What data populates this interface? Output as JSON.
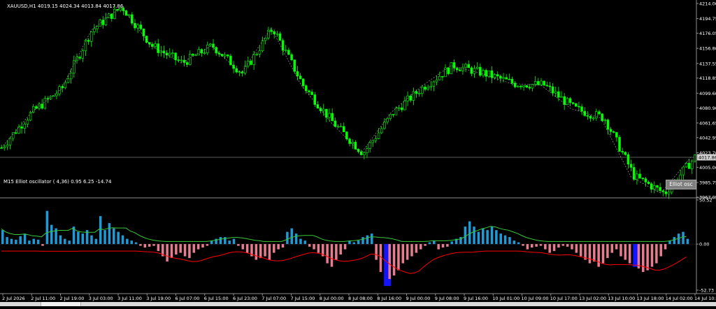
{
  "main": {
    "header": "XAUUSD,H1  4019.15 4024.34 4013.84 4017.86",
    "price_ticks": [
      "4214.00",
      "4194.75",
      "4176.05",
      "4156.80",
      "4137.55",
      "4118.85",
      "4099.60",
      "4080.90",
      "4061.65",
      "4042.95",
      "4023.70",
      "4005.00",
      "3985.75",
      "3967.05"
    ],
    "price_ticks_values": [
      4214.0,
      4194.75,
      4176.05,
      4156.8,
      4137.55,
      4118.85,
      4099.6,
      4080.9,
      4061.65,
      4042.95,
      4023.7,
      4005.0,
      3985.75,
      3967.05
    ],
    "current_price": "4017.86",
    "current_price_value": 4017.86
  },
  "oscillator": {
    "header": "M15 Elliot oscillator ( 4,36) 0.95 6.25 -14.74",
    "button_label": "Elliot osc",
    "ticks": [
      "50.52",
      "0.00",
      "-52.73"
    ],
    "tick_values": [
      50.52,
      0.0,
      -52.73
    ]
  },
  "time_axis": [
    "2 Jul 2026",
    "2 Jul 11:00",
    "2 Jul 19:00",
    "3 Jul 03:00",
    "3 Jul 11:00",
    "3 Jul 19:00",
    "6 Jul 07:00",
    "6 Jul 15:00",
    "6 Jul 23:00",
    "7 Jul 07:00",
    "7 Jul 15:00",
    "8 Jul 00:00",
    "8 Jul 08:00",
    "8 Jul 16:00",
    "9 Jul 00:00",
    "9 Jul 08:00",
    "9 Jul 16:00",
    "10 Jul 01:00",
    "10 Jul 09:00",
    "10 Jul 17:00",
    "13 Jul 02:00",
    "13 Jul 10:00",
    "13 Jul 18:00",
    "14 Jul 02:00",
    "14 Jul 10:00"
  ],
  "colors": {
    "bull": "#00ff00",
    "bear": "#00ff00",
    "osc_pos": "#1e9ad6",
    "osc_neg": "#e77c8f",
    "signal": "#38c938",
    "signal2": "#ff0000",
    "highlight": "#1414ff",
    "zigzag": "#b0b0b0"
  },
  "chart_data": [
    {
      "type": "candlestick",
      "title": "XAUUSD,H1",
      "ylim": [
        3967.05,
        4214.0
      ],
      "ohlc_pivots": [
        {
          "x": "2 Jul 2026",
          "y": 4030
        },
        {
          "x": "2 Jul 11:00",
          "y": 4075
        },
        {
          "x": "2 Jul 19:00",
          "y": 4105
        },
        {
          "x": "3 Jul 03:00",
          "y": 4180
        },
        {
          "x": "3 Jul 19:00",
          "y": 4210
        },
        {
          "x": "6 Jul 07:00",
          "y": 4160
        },
        {
          "x": "6 Jul 15:00",
          "y": 4138
        },
        {
          "x": "6 Jul 23:00",
          "y": 4160
        },
        {
          "x": "7 Jul 07:00",
          "y": 4125
        },
        {
          "x": "7 Jul 15:00",
          "y": 4183
        },
        {
          "x": "8 Jul 00:00",
          "y": 4110
        },
        {
          "x": "8 Jul 08:00",
          "y": 4062
        },
        {
          "x": "8 Jul 16:00",
          "y": 4023
        },
        {
          "x": "9 Jul 00:00",
          "y": 4075
        },
        {
          "x": "9 Jul 08:00",
          "y": 4108
        },
        {
          "x": "9 Jul 16:00",
          "y": 4135
        },
        {
          "x": "10 Jul 01:00",
          "y": 4125
        },
        {
          "x": "10 Jul 09:00",
          "y": 4112
        },
        {
          "x": "10 Jul 17:00",
          "y": 4110
        },
        {
          "x": "13 Jul 02:00",
          "y": 4080
        },
        {
          "x": "13 Jul 10:00",
          "y": 4068
        },
        {
          "x": "13 Jul 18:00",
          "y": 3993
        },
        {
          "x": "14 Jul 02:00",
          "y": 3972
        },
        {
          "x": "14 Jul 10:00",
          "y": 4018
        }
      ],
      "current_price": 4017.86
    },
    {
      "type": "bar",
      "title": "M15 Elliot oscillator ( 4,36) 0.95 6.25 -14.74",
      "ylim": [
        -52.73,
        50.52
      ],
      "values": [
        16,
        8,
        6,
        5,
        9,
        12,
        4,
        6,
        5,
        -2,
        38,
        22,
        18,
        10,
        6,
        4,
        20,
        14,
        12,
        16,
        10,
        6,
        32,
        16,
        24,
        18,
        14,
        10,
        6,
        4,
        2,
        -2,
        -4,
        -3,
        -2,
        -8,
        -14,
        -20,
        -16,
        -12,
        -10,
        -14,
        -16,
        -10,
        -6,
        -4,
        -2,
        4,
        6,
        8,
        8,
        4,
        6,
        -2,
        -6,
        -10,
        -14,
        -18,
        -16,
        -14,
        -18,
        -10,
        -6,
        -4,
        14,
        18,
        12,
        6,
        4,
        -3,
        -6,
        -10,
        -14,
        -22,
        -26,
        -18,
        -12,
        -6,
        4,
        2,
        4,
        8,
        10,
        12,
        -18,
        -32,
        -48,
        -40,
        -36,
        -30,
        -22,
        -18,
        -14,
        -10,
        -6,
        -2,
        2,
        4,
        -6,
        -4,
        -3,
        3,
        6,
        8,
        20,
        26,
        20,
        14,
        18,
        16,
        20,
        16,
        12,
        10,
        8,
        4,
        2,
        -2,
        -6,
        -4,
        -3,
        -2,
        -6,
        -10,
        -8,
        -4,
        -2,
        -3,
        -6,
        -10,
        -14,
        -18,
        -22,
        -20,
        -26,
        -22,
        -16,
        -10,
        -6,
        -14,
        -18,
        -22,
        -26,
        -28,
        -32,
        -30,
        -26,
        -22,
        -14,
        -6,
        4,
        8,
        12,
        14,
        6
      ]
    }
  ]
}
